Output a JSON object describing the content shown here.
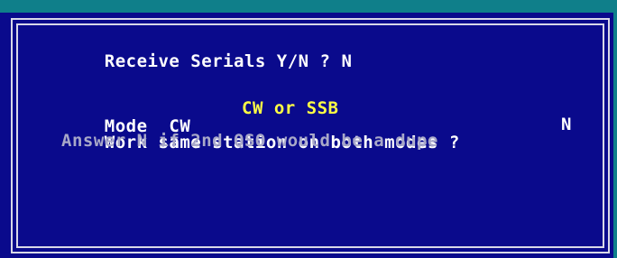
{
  "screen": {
    "colors": {
      "background": "#0a0a8c",
      "frame": "#d8d8e8",
      "accent_bar": "#0f7f8a",
      "text_white": "#ffffff",
      "text_yellow": "#ffff44",
      "text_gray": "#a8a8c8"
    },
    "receive_serials": {
      "prompt": "Receive Serials Y/N ? ",
      "value": "N"
    },
    "mode": {
      "label": "Mode  ",
      "value": "CW",
      "options_hint": "CW or SSB"
    },
    "work_same_station": {
      "prompt": "Work same station on both modes ?",
      "value": "N"
    },
    "help_text": "Answer N if 2nd QSO would be a dupe"
  }
}
